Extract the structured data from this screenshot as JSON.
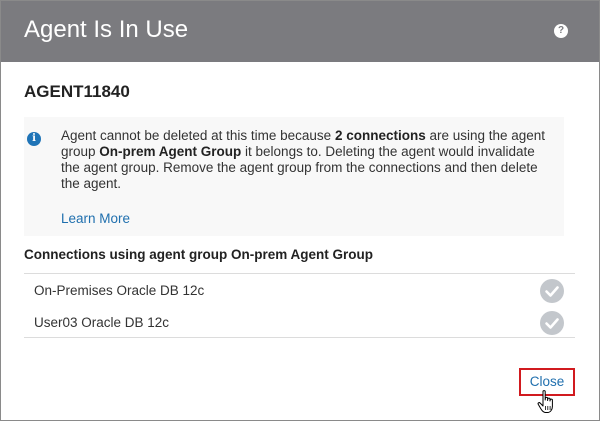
{
  "dialog": {
    "title": "Agent Is In Use",
    "help_icon": "question-circle-icon",
    "help_glyph": "?"
  },
  "agent": {
    "name": "AGENT11840"
  },
  "info": {
    "icon": "info-circle-icon",
    "icon_glyph": "i",
    "text_part1": "Agent cannot be deleted at this time because ",
    "text_bold1": "2 connections",
    "text_part2": " are using the agent group ",
    "text_bold2": "On-prem Agent Group",
    "text_part3": " it belongs to. Deleting the agent would invalidate the agent group. Remove the agent group from the connections and then delete the agent.",
    "learn_more": "Learn More"
  },
  "connections": {
    "heading": "Connections using agent group On-prem Agent Group",
    "items": [
      {
        "name": "On-Premises Oracle DB 12c",
        "status_icon": "check-circle-icon"
      },
      {
        "name": "User03 Oracle DB 12c",
        "status_icon": "check-circle-icon"
      }
    ]
  },
  "footer": {
    "close_label": "Close"
  },
  "colors": {
    "header_bg": "#7b7b7f",
    "link": "#1f6fae",
    "info_icon": "#1f74b7",
    "highlight_border": "#d11a1f",
    "check_bg": "#c3c7cc"
  }
}
